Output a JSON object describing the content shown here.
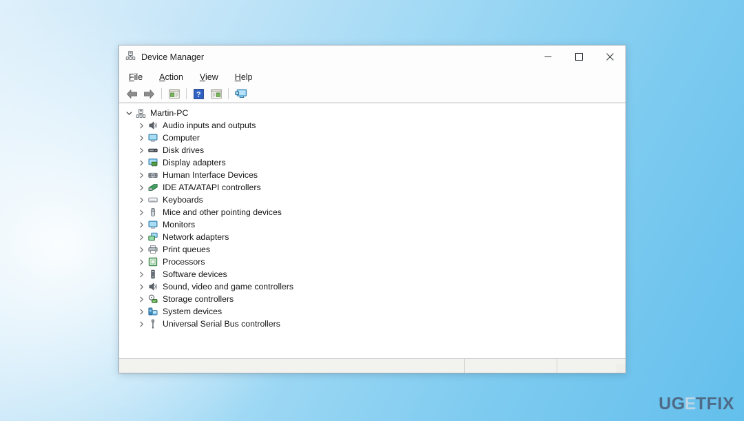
{
  "window": {
    "title": "Device Manager",
    "icon": "device-manager-icon",
    "controls": [
      {
        "name": "minimize-button",
        "glyph": "minimize-icon"
      },
      {
        "name": "maximize-button",
        "glyph": "maximize-icon"
      },
      {
        "name": "close-button",
        "glyph": "close-icon"
      }
    ]
  },
  "menubar": {
    "items": [
      {
        "name": "menu-file",
        "accel": "F",
        "rest": "ile"
      },
      {
        "name": "menu-action",
        "accel": "A",
        "rest": "ction"
      },
      {
        "name": "menu-view",
        "accel": "V",
        "rest": "iew"
      },
      {
        "name": "menu-help",
        "accel": "H",
        "rest": "elp"
      }
    ]
  },
  "toolbar": {
    "buttons": [
      {
        "name": "back-button",
        "icon": "back-arrow-icon"
      },
      {
        "name": "forward-button",
        "icon": "forward-arrow-icon"
      },
      {
        "name": "separator-1",
        "icon": "separator"
      },
      {
        "name": "properties-button",
        "icon": "properties-icon"
      },
      {
        "name": "separator-2",
        "icon": "separator"
      },
      {
        "name": "help-button",
        "icon": "help-icon"
      },
      {
        "name": "update-driver-button",
        "icon": "update-driver-icon"
      },
      {
        "name": "separator-3",
        "icon": "separator"
      },
      {
        "name": "scan-hardware-button",
        "icon": "scan-hardware-icon"
      }
    ]
  },
  "tree": {
    "root": {
      "label": "Martin-PC",
      "icon": "computer-node-icon",
      "expanded": true,
      "chevron": "chevron-down-icon"
    },
    "items": [
      {
        "label": "Audio inputs and outputs",
        "icon": "speaker-icon"
      },
      {
        "label": "Computer",
        "icon": "monitor-icon"
      },
      {
        "label": "Disk drives",
        "icon": "disk-drive-icon"
      },
      {
        "label": "Display adapters",
        "icon": "display-adapter-icon"
      },
      {
        "label": "Human Interface Devices",
        "icon": "hid-icon"
      },
      {
        "label": "IDE ATA/ATAPI controllers",
        "icon": "ide-controller-icon"
      },
      {
        "label": "Keyboards",
        "icon": "keyboard-icon"
      },
      {
        "label": "Mice and other pointing devices",
        "icon": "mouse-icon"
      },
      {
        "label": "Monitors",
        "icon": "monitor-icon"
      },
      {
        "label": "Network adapters",
        "icon": "network-adapter-icon"
      },
      {
        "label": "Print queues",
        "icon": "printer-icon"
      },
      {
        "label": "Processors",
        "icon": "processor-icon"
      },
      {
        "label": "Software devices",
        "icon": "software-device-icon"
      },
      {
        "label": "Sound, video and game controllers",
        "icon": "sound-controller-icon"
      },
      {
        "label": "Storage controllers",
        "icon": "storage-controller-icon"
      },
      {
        "label": "System devices",
        "icon": "system-device-icon"
      },
      {
        "label": "Universal Serial Bus controllers",
        "icon": "usb-controller-icon"
      }
    ],
    "child_chevron": "chevron-right-icon"
  },
  "statusbar": {
    "main_text": "",
    "panel_a_text": "",
    "panel_b_text": ""
  },
  "watermark": {
    "part1": "UG",
    "part2": "E",
    "part3": "TFIX"
  },
  "colors": {
    "desktop_gradient_light": "#dff0fb",
    "desktop_gradient_dark": "#63bfec",
    "window_bg": "#ffffff",
    "statusbar_bg": "#f2f2ee",
    "watermark_color": "#4e6a86"
  }
}
